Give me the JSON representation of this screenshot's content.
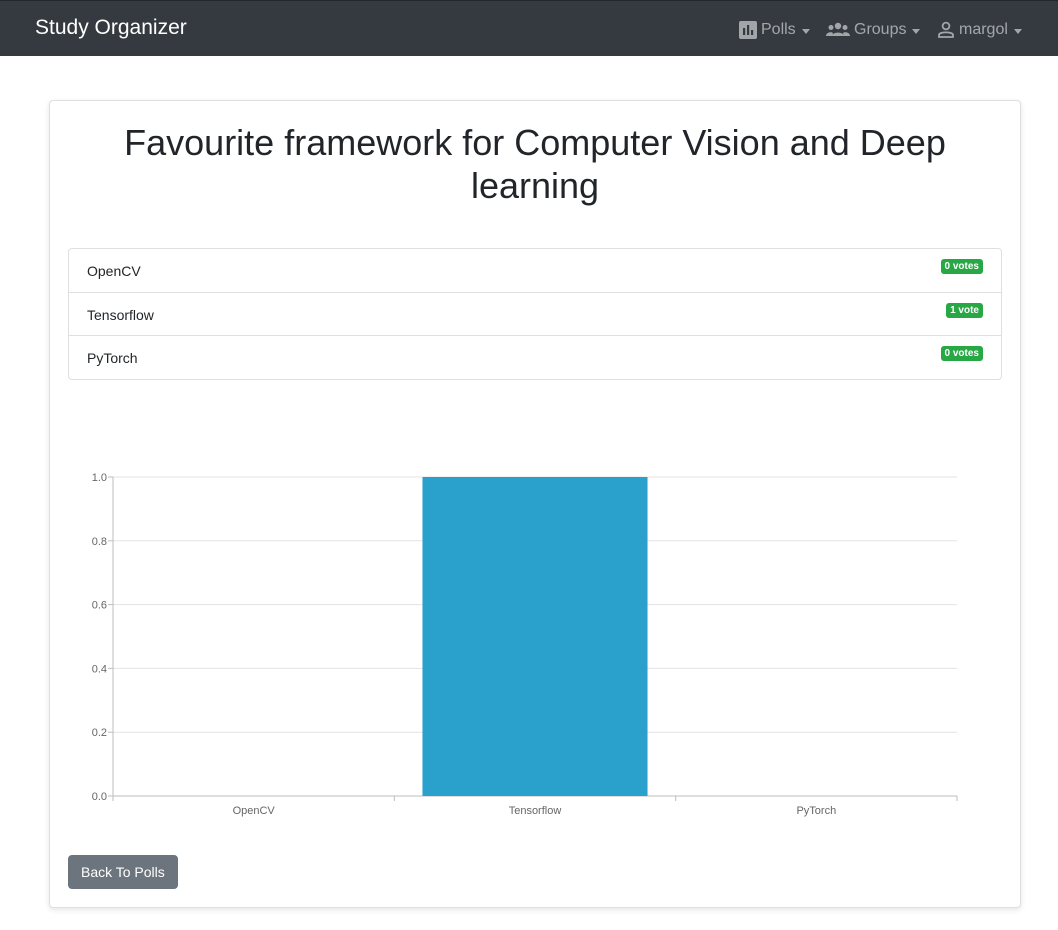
{
  "navbar": {
    "brand": "Study Organizer",
    "items": [
      {
        "label": "Polls",
        "icon": "bar-chart-icon"
      },
      {
        "label": "Groups",
        "icon": "people-icon"
      },
      {
        "label": "margol",
        "icon": "user-icon"
      }
    ]
  },
  "poll": {
    "title": "Favourite framework for Computer Vision and Deep learning",
    "options": [
      {
        "label": "OpenCV",
        "votes_label": "0 votes"
      },
      {
        "label": "Tensorflow",
        "votes_label": "1 vote"
      },
      {
        "label": "PyTorch",
        "votes_label": "0 votes"
      }
    ]
  },
  "chart_data": {
    "type": "bar",
    "categories": [
      "OpenCV",
      "Tensorflow",
      "PyTorch"
    ],
    "values": [
      0,
      1,
      0
    ],
    "ylim": [
      0,
      1
    ],
    "yticks": [
      "0.0",
      "0.2",
      "0.4",
      "0.6",
      "0.8",
      "1.0"
    ],
    "grid": true,
    "bar_color": "#2aa1cc",
    "title": "",
    "xlabel": "",
    "ylabel": ""
  },
  "actions": {
    "back_label": "Back To Polls"
  },
  "colors": {
    "navbar_bg": "#343a40",
    "badge_success": "#28a745",
    "button_secondary": "#6c757d"
  }
}
